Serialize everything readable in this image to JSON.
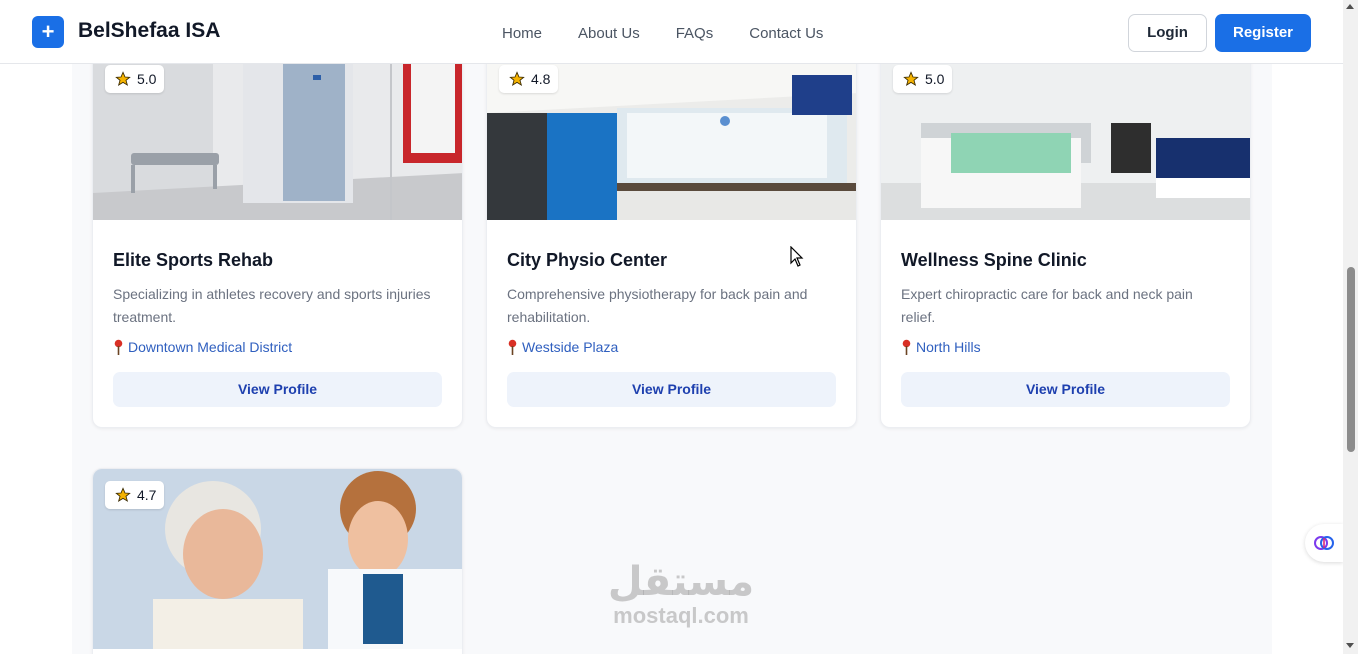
{
  "header": {
    "logo_symbol": "+",
    "brand": "BelShefaa ISA",
    "nav": [
      "Home",
      "About Us",
      "FAQs",
      "Contact Us"
    ],
    "login_label": "Login",
    "register_label": "Register",
    "accent_color": "#1a6fe6"
  },
  "clinics": [
    {
      "rating": "5.0",
      "name": "Elite Sports Rehab",
      "description": "Specializing in athletes recovery and sports injuries treatment.",
      "location": "Downtown Medical District",
      "button": "View Profile"
    },
    {
      "rating": "4.8",
      "name": "City Physio Center",
      "description": "Comprehensive physiotherapy for back pain and rehabilitation.",
      "location": "Westside Plaza",
      "button": "View Profile"
    },
    {
      "rating": "5.0",
      "name": "Wellness Spine Clinic",
      "description": "Expert chiropractic care for back and neck pain relief.",
      "location": "North Hills",
      "button": "View Profile"
    },
    {
      "rating": "4.7"
    }
  ],
  "watermark": {
    "arabic": "مستقل",
    "latin": "mostaql.com"
  },
  "icons": {
    "rating": "star-icon",
    "location": "map-pin-icon",
    "widget": "brain-icon"
  }
}
